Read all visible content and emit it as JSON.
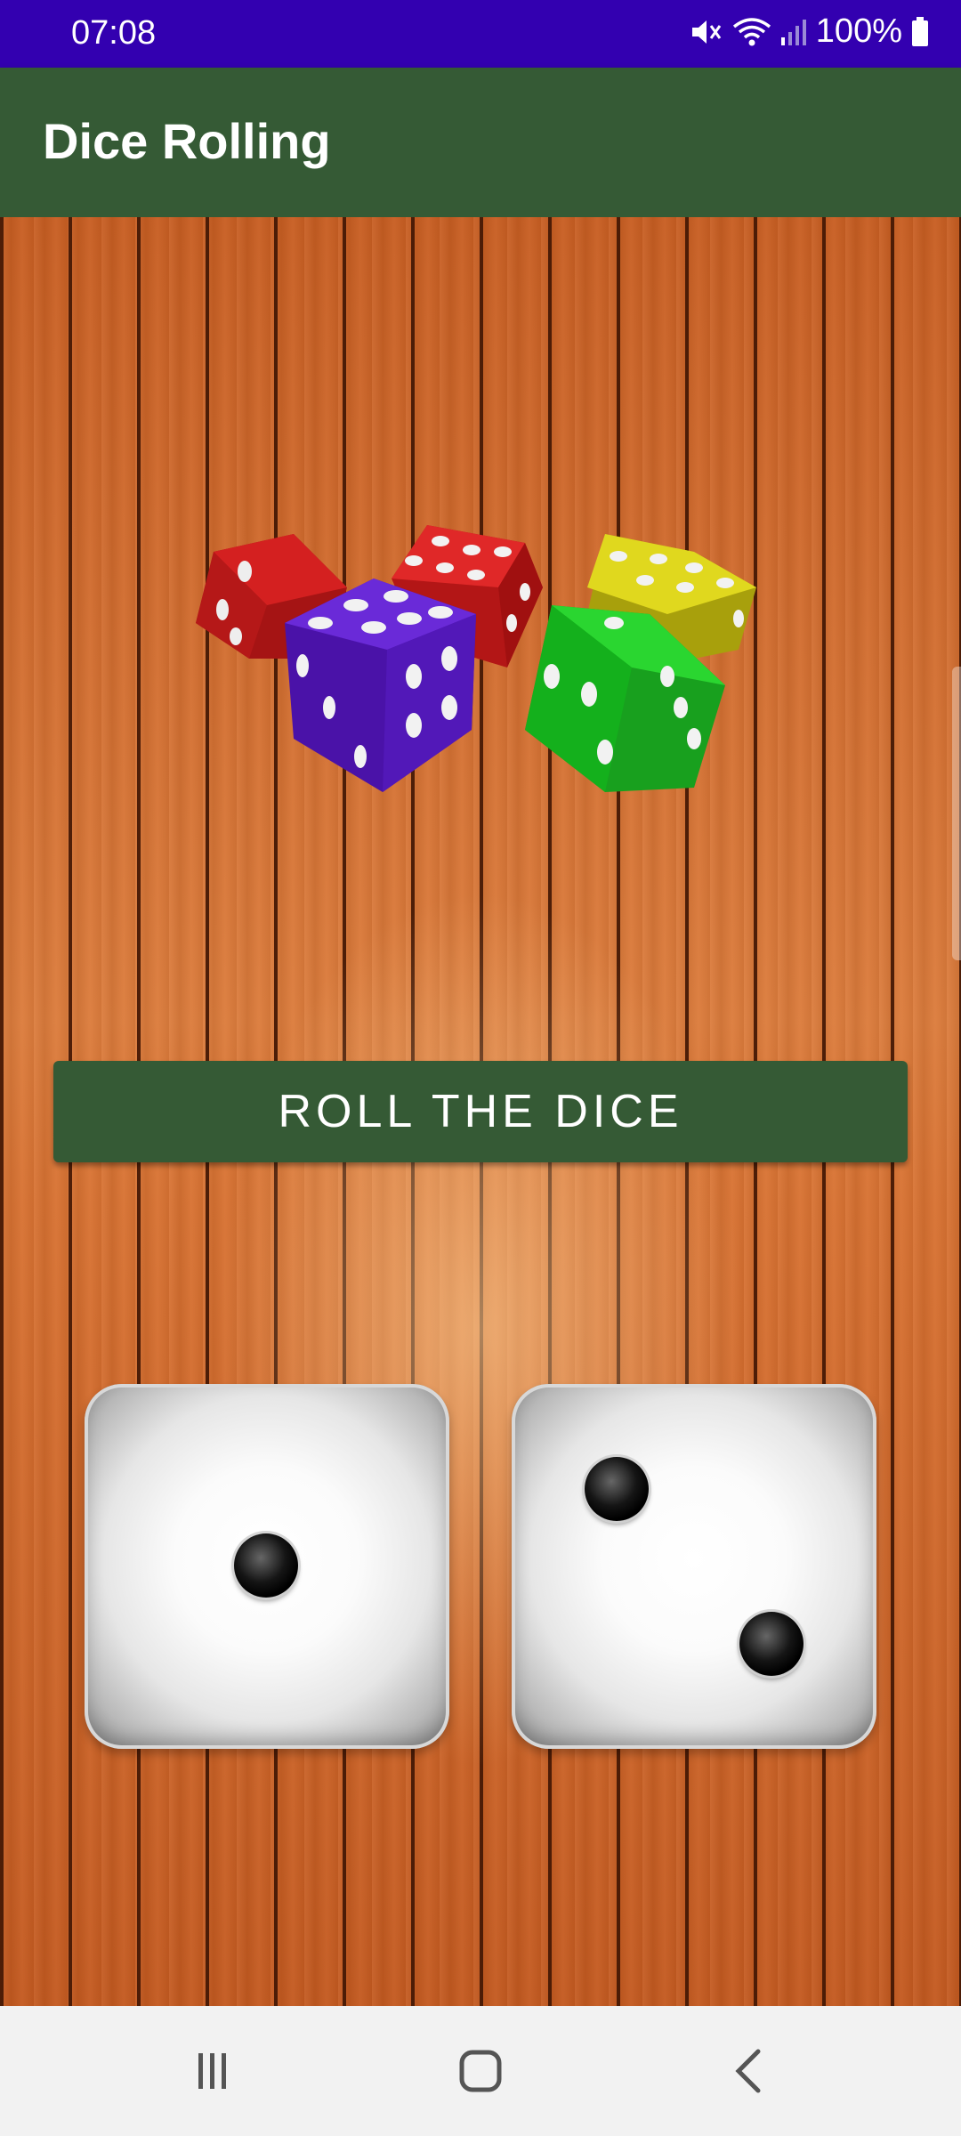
{
  "status_bar": {
    "time": "07:08",
    "battery_text": "100%",
    "icons": [
      "mute-icon",
      "wifi-icon",
      "signal-icon",
      "battery-icon"
    ]
  },
  "app_bar": {
    "title": "Dice Rolling"
  },
  "main": {
    "roll_button_label": "ROLL THE DICE",
    "dice": [
      {
        "name": "left-die",
        "value": 1
      },
      {
        "name": "right-die",
        "value": 2
      }
    ]
  },
  "nav_bar": {
    "buttons": [
      "recents-icon",
      "home-icon",
      "back-icon"
    ]
  },
  "colors": {
    "status_bar": "#3300b0",
    "app_bar": "#355a35",
    "button": "#355a35",
    "wood": "#d2692c"
  }
}
